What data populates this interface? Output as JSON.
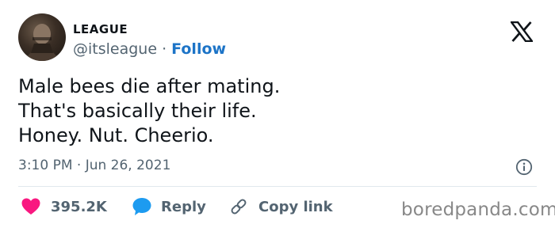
{
  "author": {
    "display_name": "LEAGUE",
    "handle": "@itsleague",
    "separator": "·",
    "follow_label": "Follow"
  },
  "tweet": {
    "lines": [
      "Male bees die after mating.",
      "That's basically their life.",
      "Honey. Nut. Cheerio."
    ],
    "timestamp": "3:10 PM · Jun 26, 2021"
  },
  "actions": {
    "like_count": "395.2K",
    "reply_label": "Reply",
    "copy_link_label": "Copy link"
  },
  "icons": {
    "platform": "x-logo-icon",
    "info": "info-icon",
    "like": "heart-icon",
    "reply": "speech-bubble-icon",
    "copy": "link-icon"
  },
  "colors": {
    "follow": "#1d74c7",
    "like": "#f91880",
    "reply": "#1d9bf0",
    "muted": "#536471"
  },
  "watermark": "boredpanda.com"
}
